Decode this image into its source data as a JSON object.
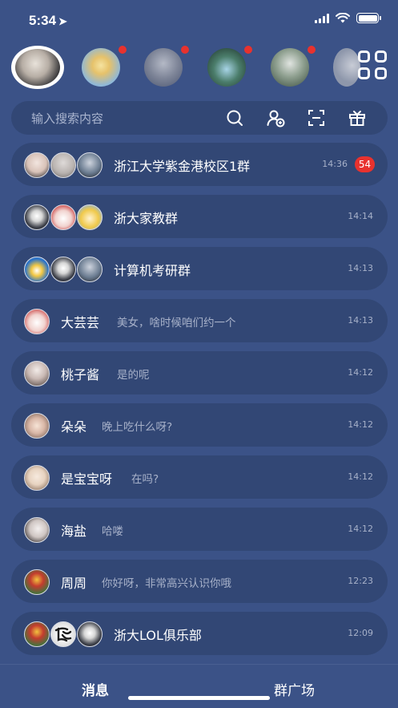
{
  "status_bar": {
    "time": "5:34",
    "location_arrow": "➤"
  },
  "stories": [
    {
      "name": "story-0",
      "active": true,
      "unread": false,
      "color": "#c9c2b8"
    },
    {
      "name": "story-1",
      "active": false,
      "unread": true,
      "color": "#a9c9e0"
    },
    {
      "name": "story-2",
      "active": false,
      "unread": true,
      "color": "#8d98b0"
    },
    {
      "name": "story-3",
      "active": false,
      "unread": true,
      "color": "#4f7a6a"
    },
    {
      "name": "story-4",
      "active": false,
      "unread": true,
      "color": "#6e8a7a"
    },
    {
      "name": "story-5",
      "active": false,
      "unread": false,
      "color": "#9aa5bb"
    }
  ],
  "search": {
    "placeholder": "输入搜索内容"
  },
  "chats": [
    {
      "name": "浙江大学紫金港校区1群",
      "message": "",
      "time": "14:36",
      "badge": "54",
      "avatars": [
        "#e8d8cf",
        "#c4c0bf",
        "#6b7c91"
      ]
    },
    {
      "name": "浙大家教群",
      "message": "",
      "time": "14:14",
      "badge": "",
      "avatars": [
        "#4a4f5e",
        "#f1d3cf",
        "#e8d38a"
      ]
    },
    {
      "name": "计算机考研群",
      "message": "",
      "time": "14:13",
      "badge": "",
      "avatars": [
        "#6fa6e0",
        "#4a4f5e",
        "#6b7c91"
      ]
    },
    {
      "name": "大芸芸",
      "message": "美女，啥时候咱们约一个",
      "time": "14:13",
      "badge": "",
      "avatars": [
        "#f1d3cf"
      ]
    },
    {
      "name": "桃子酱",
      "message": "是的呢",
      "time": "14:12",
      "badge": "",
      "avatars": [
        "#c9b9b4"
      ]
    },
    {
      "name": "朵朵",
      "message": "晚上吃什么呀?",
      "time": "14:12",
      "badge": "",
      "avatars": [
        "#d9b7a7"
      ]
    },
    {
      "name": "是宝宝呀",
      "message": "在吗?",
      "time": "14:12",
      "badge": "",
      "avatars": [
        "#e7d3c0"
      ]
    },
    {
      "name": "海盐",
      "message": "哈喽",
      "time": "14:12",
      "badge": "",
      "avatars": [
        "#cfc6c3"
      ]
    },
    {
      "name": "周周",
      "message": "你好呀，非常高兴认识你哦",
      "time": "12:23",
      "badge": "",
      "avatars": [
        "#4f6e3c"
      ]
    },
    {
      "name": "浙大LOL俱乐部",
      "message": "",
      "time": "12:09",
      "badge": "",
      "avatars": [
        "#4f6e3c",
        "#f3f3f3",
        "#5a5f6e"
      ]
    }
  ],
  "tabs": {
    "messages": "消息",
    "square": "群广场"
  },
  "colors": {
    "background": "#3b5287",
    "row": "#324775",
    "badge": "#e8322e",
    "muted": "#a7b1c9"
  }
}
